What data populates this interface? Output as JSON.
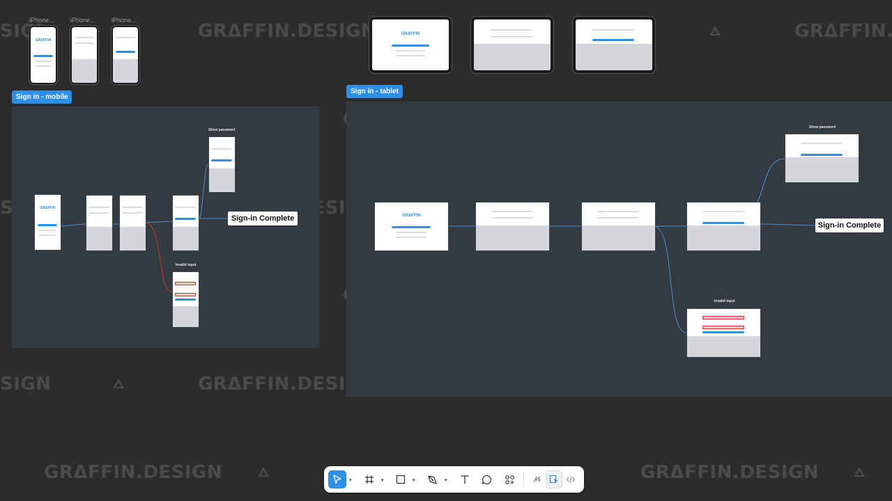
{
  "watermark": {
    "text": "GRΔFFIN.DESIGN",
    "partial_left": "SIGN",
    "partial_right": "GRΔFFIN.DE",
    "partial_left2": "SIGI"
  },
  "sections": {
    "mobile": {
      "label": "Sign in - mobile"
    },
    "tablet": {
      "label": "Sign in - tablet"
    }
  },
  "top_frames": {
    "iphone_labels": [
      "iPhone...",
      "iPhone...",
      "iPhone..."
    ]
  },
  "flow": {
    "mobile_show_password": "Show password",
    "mobile_invalid_input": "Invalid input",
    "mobile_complete": "Sign-in Complete",
    "tablet_show_password": "Show password",
    "tablet_invalid_input": "Invalid input",
    "tablet_complete": "Sign-in Complete"
  },
  "screen_text": {
    "brand": "GRΔFFIN"
  },
  "colors": {
    "canvas": "#2c2c2c",
    "section": "#333a42",
    "accent": "#2f8fe6",
    "error": "#d33333"
  },
  "toolbar": {
    "tools": [
      "move-tool",
      "frame-tool",
      "shape-tool",
      "pen-tool",
      "text-tool",
      "comment-tool",
      "actions-tool"
    ],
    "modes": [
      "draw-mode",
      "design-mode",
      "dev-mode"
    ],
    "active_tool": "move-tool",
    "active_mode": "design-mode"
  }
}
